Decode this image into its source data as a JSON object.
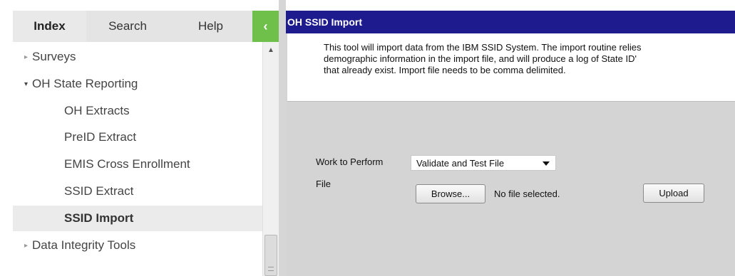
{
  "sidebar": {
    "tabs": [
      {
        "label": "Index"
      },
      {
        "label": "Search"
      },
      {
        "label": "Help"
      },
      {
        "label": "‹"
      }
    ],
    "tree": [
      {
        "label": "Surveys",
        "arrow": "▸"
      },
      {
        "label": "OH State Reporting",
        "arrow": "▾"
      },
      {
        "label": "OH Extracts"
      },
      {
        "label": "PreID Extract"
      },
      {
        "label": "EMIS Cross Enrollment"
      },
      {
        "label": "SSID Extract"
      },
      {
        "label": "SSID Import"
      },
      {
        "label": "Data Integrity Tools",
        "arrow": "▸"
      }
    ],
    "scroll_up_arrow": "▲"
  },
  "main": {
    "title": "OH SSID Import",
    "description": [
      "This tool will import data from the IBM SSID System. The import routine relies",
      "demographic information in the import file, and will produce a log of State ID'",
      "that already exist. Import file needs to be comma delimited."
    ],
    "work_label": "Work to Perform",
    "work_value": "Validate and Test File",
    "file_label": "File",
    "browse_label": "Browse...",
    "file_status": "No file selected.",
    "upload_label": "Upload"
  },
  "colors": {
    "header_bg": "#1e1b8e",
    "collapse_tab": "#6ec04a"
  }
}
